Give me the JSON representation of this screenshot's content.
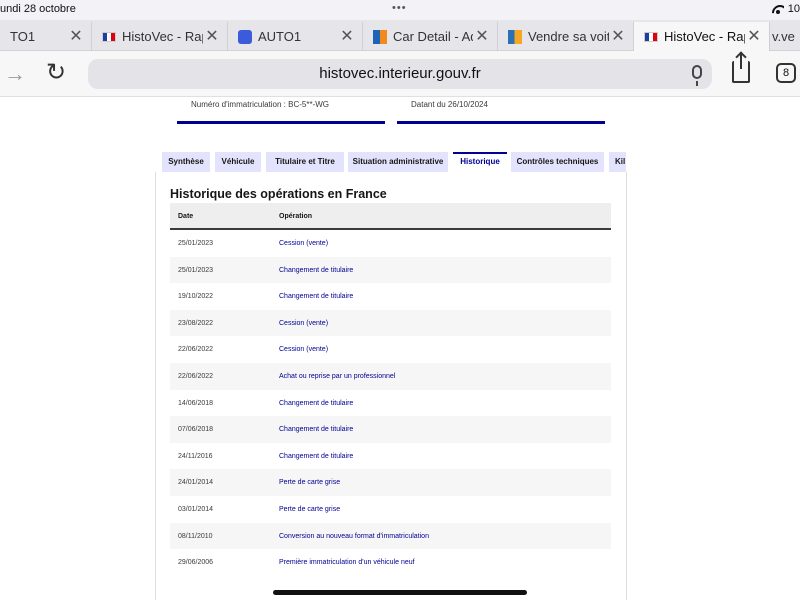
{
  "status": {
    "time": "undi 28 octobre",
    "dots": "•••",
    "battery": "10"
  },
  "browser_tabs": [
    {
      "label": "TO1",
      "favicon": "none",
      "active": false
    },
    {
      "label": "HistoVec - Rap",
      "favicon": "french-flag-icon",
      "active": false
    },
    {
      "label": "AUTO1",
      "favicon": "auto1-icon",
      "active": false
    },
    {
      "label": "Car Detail - Adv",
      "favicon": "car-detail-icon",
      "active": false
    },
    {
      "label": "Vendre sa voitu",
      "favicon": "vendre-icon",
      "active": false
    },
    {
      "label": "HistoVec - Rapp",
      "favicon": "french-flag-icon",
      "active": true
    },
    {
      "label": "v.ve",
      "favicon": "none",
      "active": false
    }
  ],
  "toolbar": {
    "url": "histovec.interieur.gouv.fr",
    "tab_count": "8"
  },
  "cards": {
    "registration": "Numéro d'immatriculation : BC-5**-WG",
    "date": "Datant du 26/10/2024"
  },
  "page_tabs": [
    {
      "label": "Synthèse",
      "active": false
    },
    {
      "label": "Véhicule",
      "active": false
    },
    {
      "label": "Titulaire et Titre",
      "active": false
    },
    {
      "label": "Situation administrative",
      "active": false
    },
    {
      "label": "Historique",
      "active": true
    },
    {
      "label": "Contrôles techniques",
      "active": false
    },
    {
      "label": "Kil",
      "active": false
    }
  ],
  "history": {
    "title": "Historique des opérations en France",
    "col_date": "Date",
    "col_operation": "Opération",
    "rows": [
      {
        "date": "25/01/2023",
        "operation": "Cession (vente)"
      },
      {
        "date": "25/01/2023",
        "operation": "Changement de titulaire"
      },
      {
        "date": "19/10/2022",
        "operation": "Changement de titulaire"
      },
      {
        "date": "23/08/2022",
        "operation": "Cession (vente)"
      },
      {
        "date": "22/06/2022",
        "operation": "Cession (vente)"
      },
      {
        "date": "22/06/2022",
        "operation": "Achat ou reprise par un professionnel"
      },
      {
        "date": "14/06/2018",
        "operation": "Changement de titulaire"
      },
      {
        "date": "07/06/2018",
        "operation": "Changement de titulaire"
      },
      {
        "date": "24/11/2016",
        "operation": "Changement de titulaire"
      },
      {
        "date": "24/01/2014",
        "operation": "Perte de carte grise"
      },
      {
        "date": "03/01/2014",
        "operation": "Perte de carte grise"
      },
      {
        "date": "08/11/2010",
        "operation": "Conversion au nouveau format d'immatriculation"
      },
      {
        "date": "29/06/2006",
        "operation": "Première immatriculation d'un véhicule neuf"
      }
    ]
  },
  "colors": {
    "accent": "#000091",
    "tab_bg": "#e3e3fd"
  }
}
